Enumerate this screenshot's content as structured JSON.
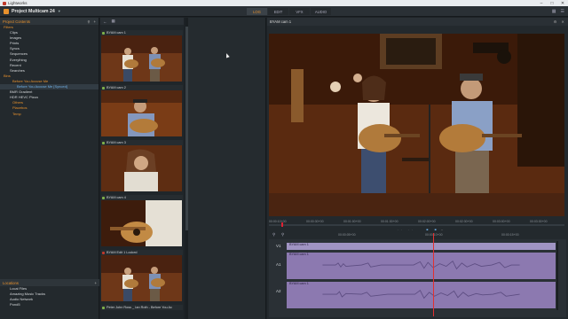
{
  "window": {
    "title": "Lightworks"
  },
  "app": {
    "project_title": "Project Multicam 24",
    "tabs": [
      {
        "label": "LOG",
        "active": true
      },
      {
        "label": "EDIT",
        "active": false
      },
      {
        "label": "VFX",
        "active": false
      },
      {
        "label": "AUDIO",
        "active": false
      }
    ],
    "accent": "#e8912d"
  },
  "sidebar": {
    "header": "Project Contents",
    "items": [
      {
        "label": "Filters",
        "kind": "group"
      },
      {
        "label": "Clips",
        "kind": "item"
      },
      {
        "label": "Images",
        "kind": "item"
      },
      {
        "label": "Prints",
        "kind": "item"
      },
      {
        "label": "Syncs",
        "kind": "item"
      },
      {
        "label": "Sequences",
        "kind": "item"
      },
      {
        "label": "Everything",
        "kind": "item"
      },
      {
        "label": "Recent",
        "kind": "item"
      },
      {
        "label": "Searches",
        "kind": "item"
      },
      {
        "label": "Bins",
        "kind": "group"
      },
      {
        "label": "Before You Accuse Me",
        "kind": "sub"
      },
      {
        "label": "Before You Accuse Me [Synced]",
        "kind": "sel"
      },
      {
        "label": "BMR Gradient",
        "kind": "item"
      },
      {
        "label": "HDR HEVC Pizza",
        "kind": "item"
      },
      {
        "label": "Others",
        "kind": "sub"
      },
      {
        "label": "Placebos",
        "kind": "sub"
      },
      {
        "label": "Temp",
        "kind": "sub"
      }
    ],
    "locations_header": "Locations",
    "locations": [
      "Local Files",
      "Amazing Music Tracks",
      "Audio Network",
      "Pond5"
    ]
  },
  "bin": {
    "clips": [
      {
        "label": "BYAM cam 1",
        "locked": false
      },
      {
        "label": "BYAM cam 2",
        "locked": false
      },
      {
        "label": "BYAM cam 3",
        "locked": false
      },
      {
        "label": "BYAM cam 4",
        "locked": false
      },
      {
        "label": "BYAM Edit 1 Locked",
        "locked": true
      },
      {
        "label": "Peter John Ross _ Ian Roth - Before You Ac",
        "locked": false
      }
    ]
  },
  "viewer": {
    "title": "BYAM cam 1",
    "ruler_ticks": [
      "00:00:10+00",
      "00:00:30+00",
      "00:01:00+00",
      "00:01:30+00",
      "00:02:00+00",
      "00:02:30+00",
      "00:03:00+00",
      "00:03:30+00"
    ],
    "timecode": "00:00:13+14",
    "tabs": [
      {
        "label": "Metadata",
        "active": false
      },
      {
        "label": "Cue Markers",
        "active": false
      },
      {
        "label": "Timeline",
        "active": true
      },
      {
        "label": "BITC",
        "active": false
      }
    ]
  },
  "timeline": {
    "ruler": [
      "00:00:05+00",
      "00:00:10+00",
      "00:00:15+00"
    ],
    "tracks": [
      {
        "id": "V1",
        "clip": "BYAM cam 1"
      },
      {
        "id": "A1",
        "clip": "BYAM cam 1"
      },
      {
        "id": "A2",
        "clip": "BYAM cam 1"
      }
    ]
  }
}
